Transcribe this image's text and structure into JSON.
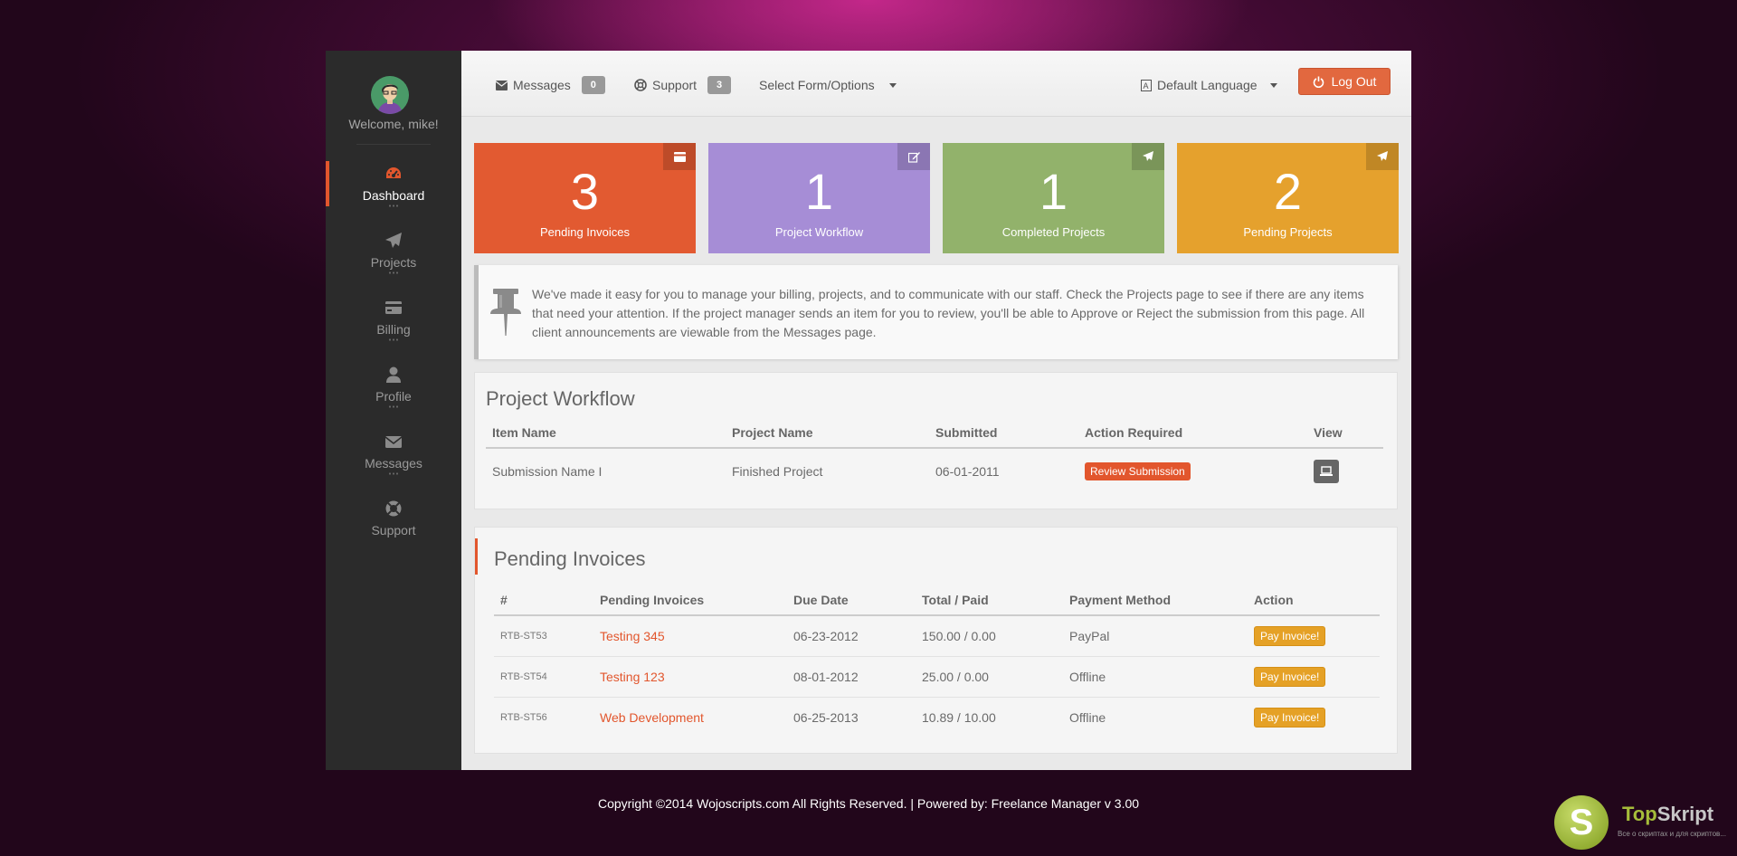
{
  "sidebar": {
    "welcome": "Welcome, mike!",
    "items": [
      {
        "label": "Dashboard",
        "icon": "dashboard-icon",
        "active": true
      },
      {
        "label": "Projects",
        "icon": "paper-plane-icon",
        "active": false
      },
      {
        "label": "Billing",
        "icon": "credit-card-icon",
        "active": false
      },
      {
        "label": "Profile",
        "icon": "user-icon",
        "active": false
      },
      {
        "label": "Messages",
        "icon": "envelope-icon",
        "active": false
      },
      {
        "label": "Support",
        "icon": "life-ring-icon",
        "active": false
      }
    ],
    "accent_color": "#e2562d"
  },
  "topbar": {
    "messages_label": "Messages",
    "messages_count": "0",
    "support_label": "Support",
    "support_count": "3",
    "form_select_label": "Select Form/Options",
    "language_label": "Default Language",
    "logout_label": "Log Out"
  },
  "tiles": [
    {
      "value": "3",
      "label": "Pending Invoices",
      "icon": "credit-card-icon",
      "color": "#e25a31"
    },
    {
      "value": "1",
      "label": "Project Workflow",
      "icon": "edit-icon",
      "color": "#a68dd6"
    },
    {
      "value": "1",
      "label": "Completed Projects",
      "icon": "paper-plane-icon",
      "color": "#92b26b"
    },
    {
      "value": "2",
      "label": "Pending Projects",
      "icon": "paper-plane-icon",
      "color": "#e5a12d"
    }
  ],
  "info": {
    "text": "We've made it easy for you to manage your billing, projects, and to communicate with our staff. Check the Projects page to see if there are any items that need your attention. If the project manager sends an item for you to review, you'll be able to Approve or Reject the submission from this page. All client announcements are viewable from the Messages page."
  },
  "workflow": {
    "title": "Project Workflow",
    "columns": [
      "Item Name",
      "Project Name",
      "Submitted",
      "Action Required",
      "View"
    ],
    "rows": [
      {
        "item": "Submission Name I",
        "project": "Finished Project",
        "submitted": "06-01-2011",
        "action": "Review Submission"
      }
    ]
  },
  "invoices": {
    "title": "Pending Invoices",
    "columns": [
      "#",
      "Pending Invoices",
      "Due Date",
      "Total / Paid",
      "Payment Method",
      "Action"
    ],
    "rows": [
      {
        "id": "RTB-ST53",
        "name": "Testing 345",
        "due": "06-23-2012",
        "total": "150.00 / 0.00",
        "method": "PayPal",
        "action": "Pay Invoice!"
      },
      {
        "id": "RTB-ST54",
        "name": "Testing 123",
        "due": "08-01-2012",
        "total": "25.00 / 0.00",
        "method": "Offline",
        "action": "Pay Invoice!"
      },
      {
        "id": "RTB-ST56",
        "name": "Web Development",
        "due": "06-25-2013",
        "total": "10.89 / 10.00",
        "method": "Offline",
        "action": "Pay Invoice!"
      }
    ]
  },
  "footer": {
    "text": "Copyright ©2014 Wojoscripts.com All Rights Reserved. | Powered by: Freelance Manager v 3.00"
  },
  "watermark": {
    "letter": "S",
    "brand_a": "Top",
    "brand_b": "Skript",
    "tagline": "Все о скриптах и для скриптов..."
  }
}
